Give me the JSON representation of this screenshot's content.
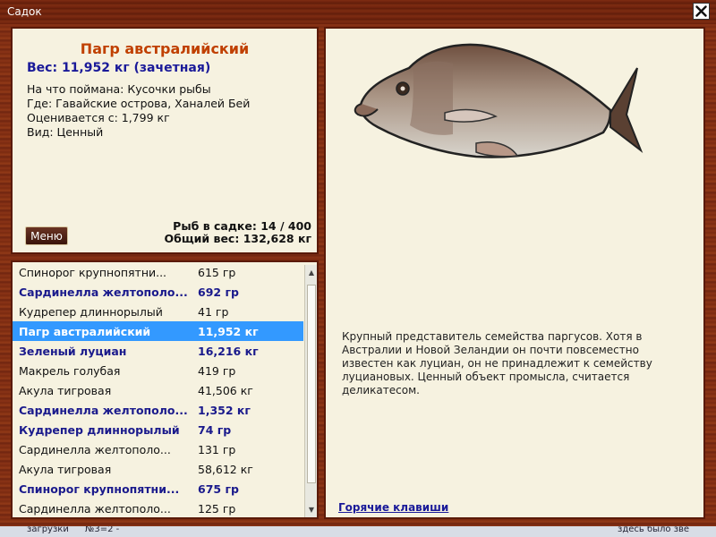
{
  "window": {
    "title": "Садок"
  },
  "fish": {
    "name": "Пагр австралийский",
    "weight_line": "Вес: 11,952 кг (зачетная)",
    "details": [
      "На что поймана: Кусочки рыбы",
      "Где: Гавайские острова, Ханалей Бей",
      "Оценивается с: 1,799 кг",
      "Вид: Ценный"
    ],
    "description": "Крупный представитель семейства паргусов. Хотя в Австралии и Новой Зеландии он почти повсеместно известен как луциан, он не принадлежит к семейству луциановых. Ценный объект промысла, считается деликатесом."
  },
  "menu_label": "Меню",
  "stats": {
    "count_line": "Рыб в садке: 14 / 400",
    "weight_line": "Общий вес: 132,628 кг"
  },
  "fish_list": [
    {
      "name": "Спинорог крупнопятни...",
      "weight": "615 гр"
    },
    {
      "name": "Сардинелла желтополо...",
      "weight": "692 гр"
    },
    {
      "name": "Кудрепер длиннорылый",
      "weight": "41 гр"
    },
    {
      "name": "Пагр австралийский",
      "weight": "11,952 кг"
    },
    {
      "name": "Зеленый луциан",
      "weight": "16,216 кг"
    },
    {
      "name": "Макрель голубая",
      "weight": "419 гр"
    },
    {
      "name": "Акула тигровая",
      "weight": "41,506 кг"
    },
    {
      "name": "Сардинелла желтополо...",
      "weight": "1,352 кг"
    },
    {
      "name": "Кудрепер длиннорылый",
      "weight": "74 гр"
    },
    {
      "name": "Сардинелла желтополо...",
      "weight": "131 гр"
    },
    {
      "name": "Акула тигровая",
      "weight": "58,612 кг"
    },
    {
      "name": "Спинорог крупнопятни...",
      "weight": "675 гр"
    },
    {
      "name": "Сардинелла желтополо...",
      "weight": "125 гр"
    }
  ],
  "hotkeys_label": "Горячие клавиши",
  "background_fragments": {
    "left_1": "загрузки",
    "left_2": "№3=2 -",
    "right": "здесь было зве"
  },
  "colors": {
    "frame_wood": "#7a2a10",
    "panel_bg": "#f6f2e0",
    "accent_title": "#c04000",
    "accent_blue": "#1a1a99",
    "selection": "#3399ff"
  },
  "icons": {
    "close": "close-icon",
    "fish": "fish-illustration"
  }
}
